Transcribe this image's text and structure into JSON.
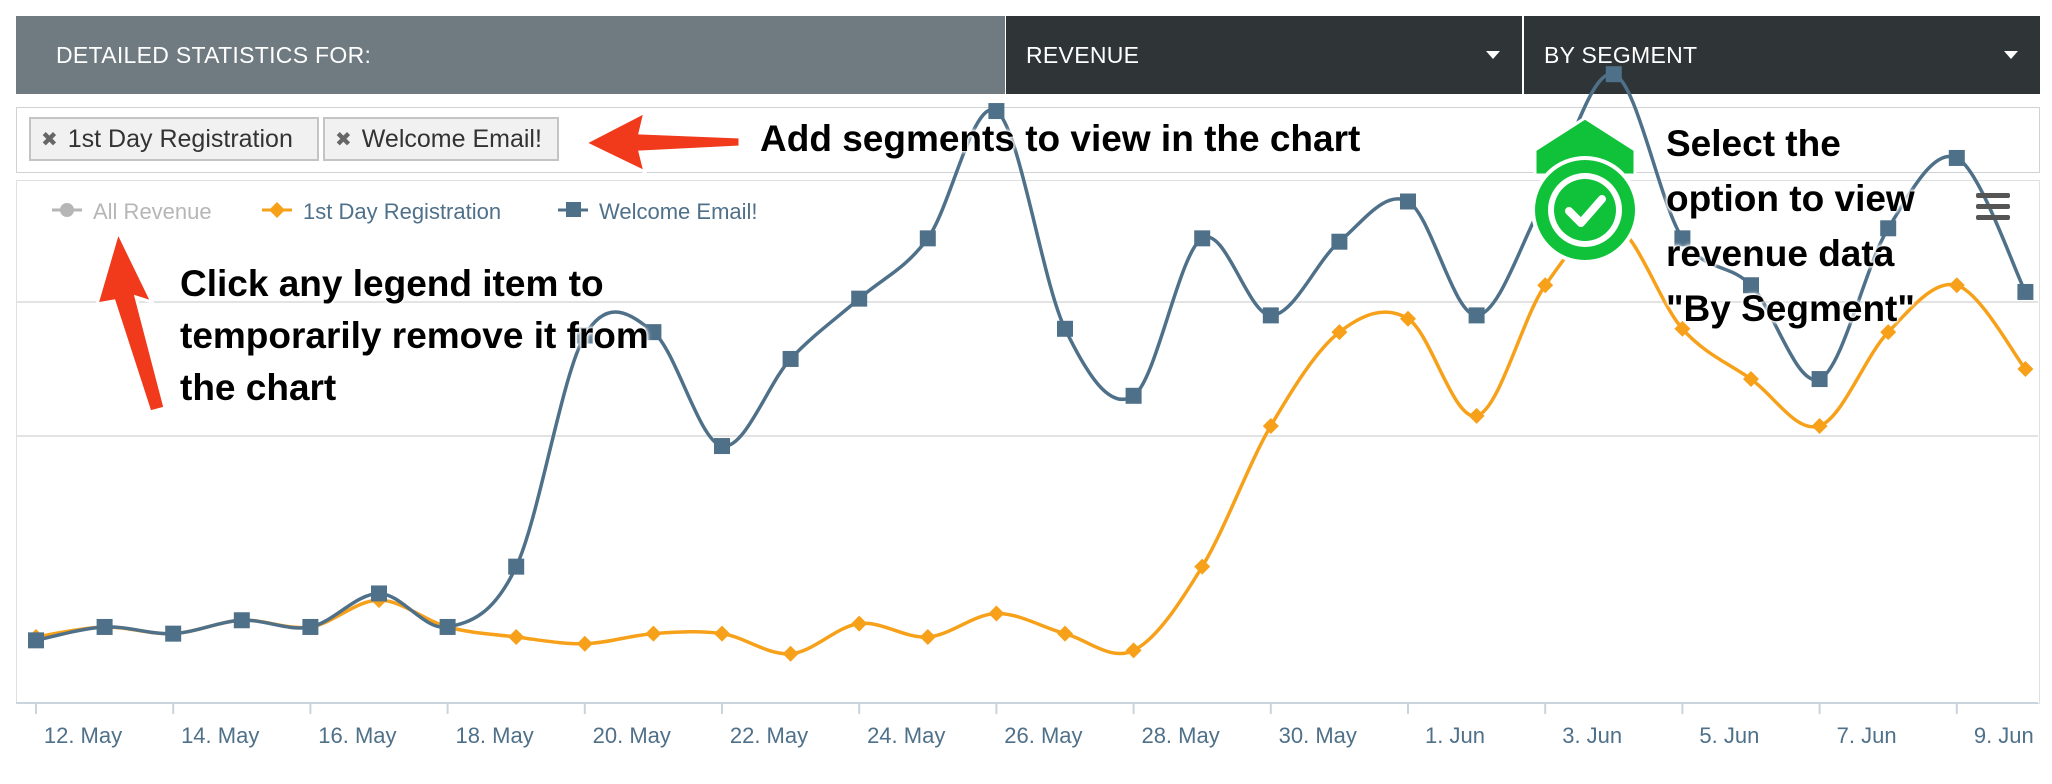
{
  "header": {
    "label": "DETAILED STATISTICS FOR:",
    "metric_dropdown": "REVENUE",
    "grouping_dropdown": "BY SEGMENT"
  },
  "segments": [
    {
      "label": "1st Day Registration",
      "remove_icon": "close-icon"
    },
    {
      "label": "Welcome Email!",
      "remove_icon": "close-icon"
    }
  ],
  "annotations": {
    "add_segments": "Add segments to view in the chart",
    "legend_tip": [
      "Click any legend item to",
      "temporarily remove it from",
      "the chart"
    ],
    "select_option": [
      "Select the",
      "option to view",
      "revenue data",
      "\"By Segment\""
    ]
  },
  "icons": {
    "menu": "hamburger-menu-icon",
    "check": "checkmark-icon",
    "arrow": "red-arrow-icon"
  },
  "colors": {
    "header_label_bg": "#6f7b81",
    "header_dropdown_bg": "#2f3537",
    "series_orange": "#f7a11a",
    "series_blue": "#4f7089",
    "legend_disabled": "#b6b6b6",
    "annotation_arrow": "#f03a1b",
    "check_badge": "#10c23a"
  },
  "chart_data": {
    "type": "line",
    "legend": [
      {
        "name": "All Revenue",
        "disabled": true
      },
      {
        "name": "1st Day Registration",
        "disabled": false
      },
      {
        "name": "Welcome Email!",
        "disabled": false
      }
    ],
    "x_ticks": [
      "12. May",
      "14. May",
      "16. May",
      "18. May",
      "20. May",
      "22. May",
      "24. May",
      "26. May",
      "28. May",
      "30. May",
      "1. Jun",
      "3. Jun",
      "5. Jun",
      "7. Jun",
      "9. Jun"
    ],
    "x": [
      "12. May",
      "13. May",
      "14. May",
      "15. May",
      "16. May",
      "17. May",
      "18. May",
      "19. May",
      "20. May",
      "21. May",
      "22. May",
      "23. May",
      "24. May",
      "25. May",
      "26. May",
      "27. May",
      "28. May",
      "29. May",
      "30. May",
      "31. May",
      "1. Jun",
      "2. Jun",
      "3. Jun",
      "4. Jun",
      "5. Jun",
      "6. Jun",
      "7. Jun",
      "8. Jun",
      "9. Jun",
      "10. Jun"
    ],
    "ylim": [
      0,
      100
    ],
    "grid": true,
    "legend_position": "top-left",
    "series": [
      {
        "name": "1st Day Registration",
        "color": "#f7a11a",
        "marker": "diamond",
        "values": [
          10,
          11.5,
          10.5,
          12.5,
          11.5,
          15.5,
          11.5,
          10,
          9,
          10.5,
          10.5,
          7.5,
          12,
          10,
          13.5,
          10.5,
          8,
          20.5,
          41.5,
          55.5,
          57.5,
          43,
          62.5,
          71.5,
          56,
          48.5,
          41.5,
          55.5,
          62.5,
          50
        ]
      },
      {
        "name": "Welcome Email!",
        "color": "#4f7089",
        "marker": "square",
        "values": [
          9.5,
          11.5,
          10.5,
          12.5,
          11.5,
          16.5,
          11.5,
          20.5,
          55,
          55.5,
          38.5,
          51.5,
          60.5,
          69.5,
          88.5,
          56,
          46,
          69.5,
          58,
          69,
          75,
          58,
          75.5,
          94,
          69.5,
          62.5,
          48.5,
          71,
          81.5,
          61.5
        ]
      }
    ]
  }
}
